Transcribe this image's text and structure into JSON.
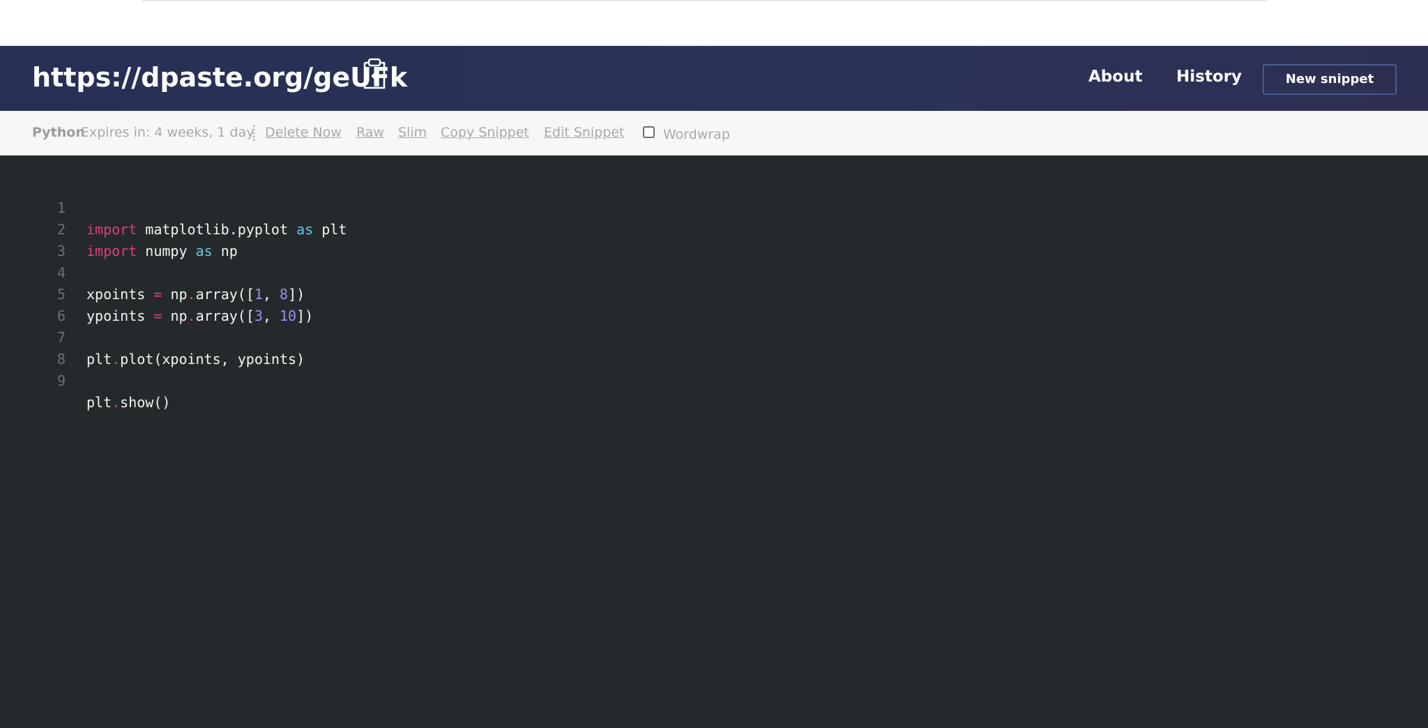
{
  "header": {
    "url": "https://dpaste.org/geUFk",
    "nav": {
      "about": "About",
      "history": "History"
    },
    "new_snippet_label": "New snippet",
    "copy_icon": "clipboard-copy-icon"
  },
  "toolbar": {
    "language": "Python",
    "expires": "Expires in: 4 weeks, 1 day",
    "links": {
      "delete": "Delete Now",
      "raw": "Raw",
      "slim": "Slim",
      "copy": "Copy Snippet",
      "edit": "Edit Snippet"
    },
    "wordwrap_label": "Wordwrap",
    "wordwrap_checked": false
  },
  "code": {
    "line_numbers": [
      "1",
      "2",
      "3",
      "4",
      "5",
      "6",
      "7",
      "8",
      "9"
    ],
    "tokens": {
      "import": "import",
      "as": "as",
      "matplotlib": "matplotlib",
      "pyplot": "pyplot",
      "plt": "plt",
      "numpy": "numpy",
      "np": "np",
      "xpoints": "xpoints",
      "ypoints": "ypoints",
      "eq": "=",
      "dot": ".",
      "array_open": "array([",
      "close": "])",
      "comma": ", ",
      "n1": "1",
      "n8": "8",
      "n3": "3",
      "n10": "10",
      "plot_call": "plot(xpoints, ypoints)",
      "show_call": "show()"
    }
  },
  "colors": {
    "header_bg": "#2b3258",
    "toolbar_bg": "#f7f7f7",
    "editor_bg": "#242a2b",
    "keyword": "#e9387a",
    "as_keyword": "#62c8ea",
    "number": "#a58af2"
  }
}
